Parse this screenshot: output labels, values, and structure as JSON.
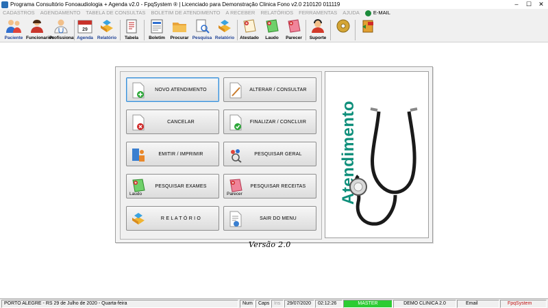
{
  "window": {
    "title": "Programa Consultório Fonoaudiologia + Agenda v2.0 - FpqSystem ® | Licenciado para  Demonstração Clinica Fono v2.0 210120 011119",
    "controls": [
      "–",
      "☐",
      "✕"
    ]
  },
  "menu": {
    "items": [
      "CADASTROS",
      "AGENDAMENTO",
      "TABELA DE CONSULTAS",
      "BOLETIM DE ATENDIMENTO",
      "A RECEBER",
      "RELATÓRIOS",
      "FERRAMENTAS",
      "AJUDA"
    ],
    "email_label": "E-MAIL"
  },
  "toolbar": {
    "items": [
      {
        "label": "Paciente",
        "icon": "users-icon"
      },
      {
        "label": "Funcionarios",
        "icon": "employee-icon"
      },
      {
        "label": "Profissional",
        "icon": "doctor-icon"
      },
      {
        "label": "Agenda",
        "icon": "calendar-icon",
        "badge": "29"
      },
      {
        "label": "Relatório",
        "icon": "report-icon"
      },
      {
        "label": "Tabela",
        "icon": "table-icon"
      },
      {
        "label": "Boletim",
        "icon": "bulletin-icon"
      },
      {
        "label": "Procurar",
        "icon": "folder-icon"
      },
      {
        "label": "Pesquisa",
        "icon": "search-doc-icon"
      },
      {
        "label": "Relatório",
        "icon": "report-icon-2"
      },
      {
        "label": "Atestado",
        "icon": "certificate-icon"
      },
      {
        "label": "Laudo",
        "icon": "laudo-icon"
      },
      {
        "label": "Parecer",
        "icon": "parecer-icon"
      },
      {
        "label": "Suporte",
        "icon": "support-icon"
      },
      {
        "label": "",
        "icon": "gold-disc-icon"
      },
      {
        "label": "",
        "icon": "exit-icon"
      }
    ]
  },
  "buttons": {
    "novo": "NOVO ATENDIMENTO",
    "alterar": "ALTERAR  /  CONSULTAR",
    "cancelar": "CANCELAR",
    "finalizar": "FINALIZAR  /  CONCLUIR",
    "emitir": "EMITIR  /  IMPRIMIR",
    "pesquisar_geral": "PESQUISAR GERAL",
    "pesquisar_exames": "PESQUISAR EXAMES",
    "pesquisar_exames_sub": "Laudo",
    "pesquisar_receitas": "PESQUISAR RECEITAS",
    "pesquisar_receitas_sub": "Parecer",
    "relatorio": "R E L A T Ó R I O",
    "sair": "SAIR DO MENU"
  },
  "side_panel": {
    "title": "Atendimento"
  },
  "version": "Versão 2.0",
  "status": {
    "location_date": "PORTO ALEGRE - RS 29 de Julho de 2020 - Quarta-feira",
    "num": "Num",
    "caps": "Caps",
    "ins": "Ins",
    "date": "29/07/2020",
    "time": "02:12:26",
    "user": "MASTER",
    "company": "DEMO CLINICA 2.0",
    "email": "Email",
    "brand": "FpqSystem"
  },
  "colors": {
    "accent_teal": "#0f8f7b",
    "status_green": "#2dcc33",
    "toolbar_label_blue": "#1c3f93"
  }
}
